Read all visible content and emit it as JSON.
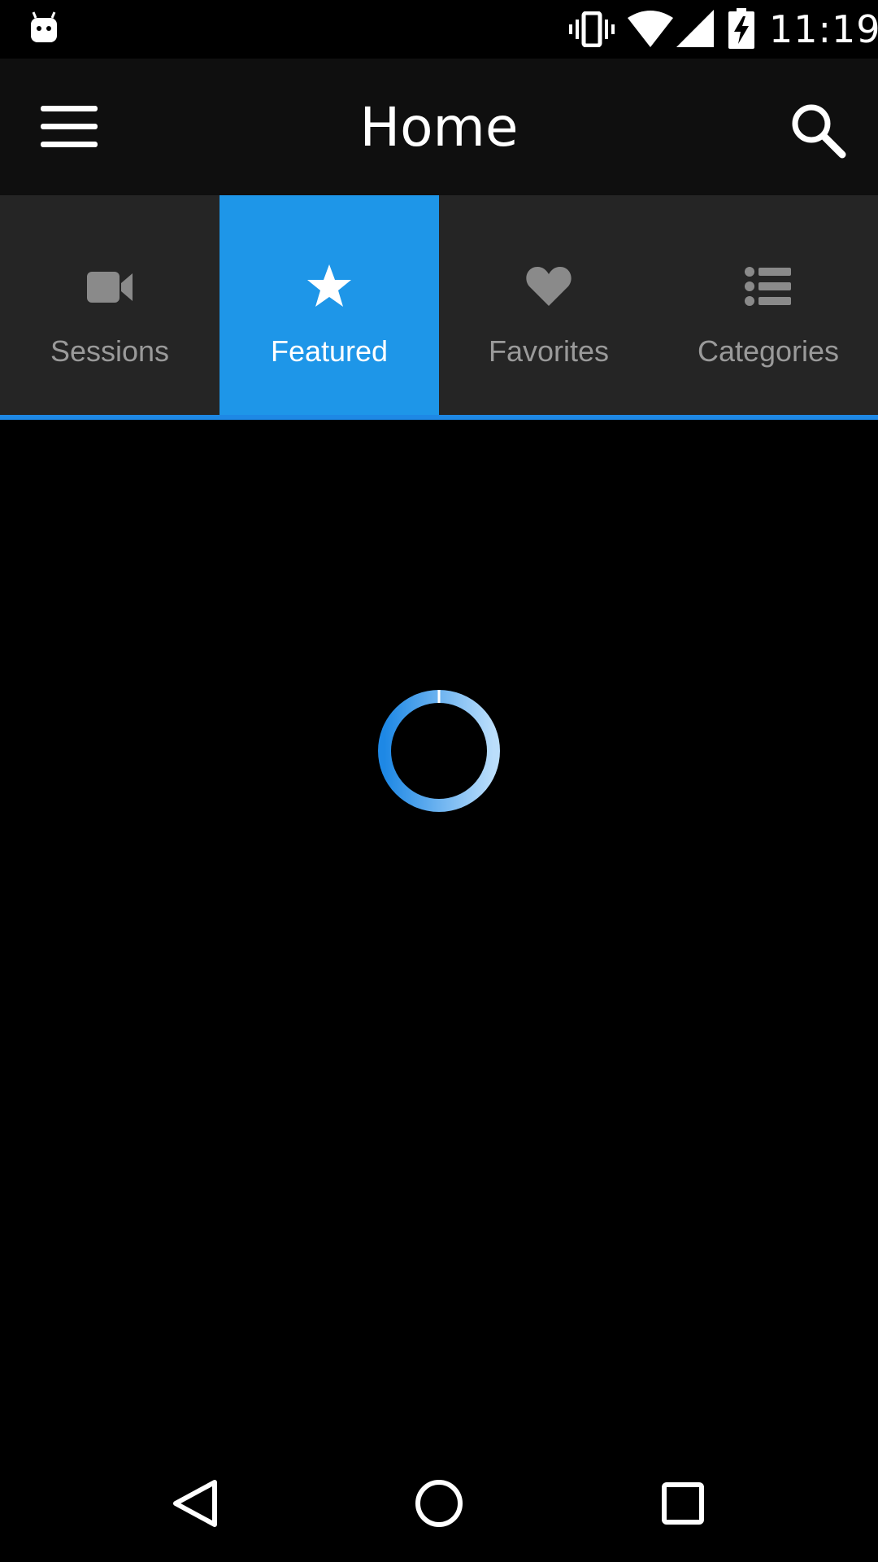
{
  "status_bar": {
    "time": "11:19",
    "icons": [
      "android-icon",
      "vibrate-icon",
      "wifi-icon",
      "signal-icon",
      "battery-charging-icon"
    ]
  },
  "toolbar": {
    "title": "Home",
    "menu_icon": "menu-icon",
    "search_icon": "search-icon"
  },
  "tabs": [
    {
      "label": "Sessions",
      "icon": "video-camera-icon",
      "active": false
    },
    {
      "label": "Featured",
      "icon": "star-icon",
      "active": true
    },
    {
      "label": "Favorites",
      "icon": "heart-icon",
      "active": false
    },
    {
      "label": "Categories",
      "icon": "list-icon",
      "active": false
    }
  ],
  "loading": true,
  "nav_bar": {
    "icons": [
      "back-icon",
      "home-icon",
      "recents-icon"
    ]
  },
  "colors": {
    "accent": "#1e96e8",
    "tab_bar": "#252525",
    "toolbar": "#0f0f0f",
    "background": "#000000",
    "inactive_tab_text": "#9a9a9a"
  }
}
